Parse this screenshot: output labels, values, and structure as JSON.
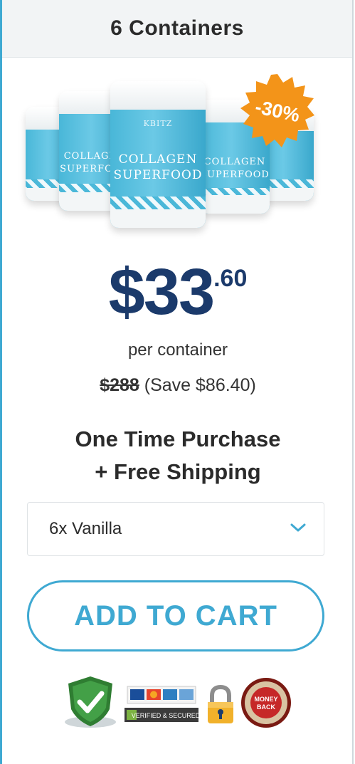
{
  "header": {
    "title": "6 Containers"
  },
  "product": {
    "jar_brand": "KBITZ",
    "jar_label_line1": "COLLAGEN",
    "jar_label_line2": "SUPERFOOD",
    "discount_badge": "-30%"
  },
  "price": {
    "dollars": "$33",
    "cents": ".60",
    "per_unit": "per container",
    "original": "$288",
    "savings": "(Save $86.40)"
  },
  "purchase": {
    "line1": "One Time Purchase",
    "line2": "+ Free Shipping"
  },
  "flavor_select": {
    "value": "6x Vanilla"
  },
  "cta": {
    "label": "ADD TO CART"
  },
  "trust_badges": {
    "secure_icon": "secure-shield-check-icon",
    "cards_icon": "payment-cards-icon",
    "verified_label": "VERIFIED & SECURED",
    "lock_icon": "padlock-icon",
    "money_back_line1": "MONEY",
    "money_back_line2": "BACK"
  },
  "colors": {
    "accent": "#3fa9d2",
    "price_text": "#1b3a6b",
    "badge_orange": "#f39419"
  }
}
